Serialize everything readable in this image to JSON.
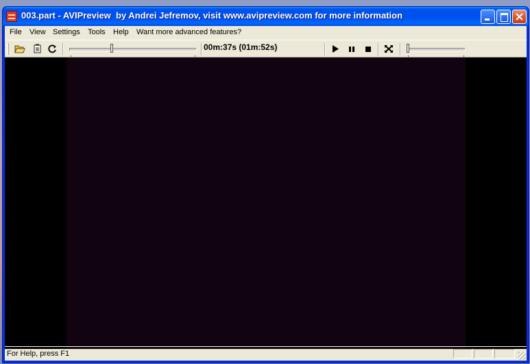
{
  "window": {
    "title": "003.part - AVIPreview  by Andrei Jefremov, visit www.avipreview.com for more information",
    "icon": "app-icon"
  },
  "menu": {
    "items": [
      "File",
      "View",
      "Settings",
      "Tools",
      "Help",
      "Want more advanced features?"
    ]
  },
  "toolbar": {
    "icons": [
      "open-folder-icon",
      "file-info-icon",
      "refresh-icon"
    ],
    "playback_icons": [
      "play-icon",
      "pause-icon",
      "stop-icon",
      "fullscreen-icon"
    ],
    "position_slider": {
      "fraction": 0.33
    },
    "volume_slider": {
      "fraction": 0.0
    },
    "time": "00m:37s (01m:52s)"
  },
  "status": {
    "text": "For Help, press F1"
  },
  "colors": {
    "titlebar": "#0053ee",
    "video_background": "#000000",
    "video_frame": "#11030f"
  }
}
